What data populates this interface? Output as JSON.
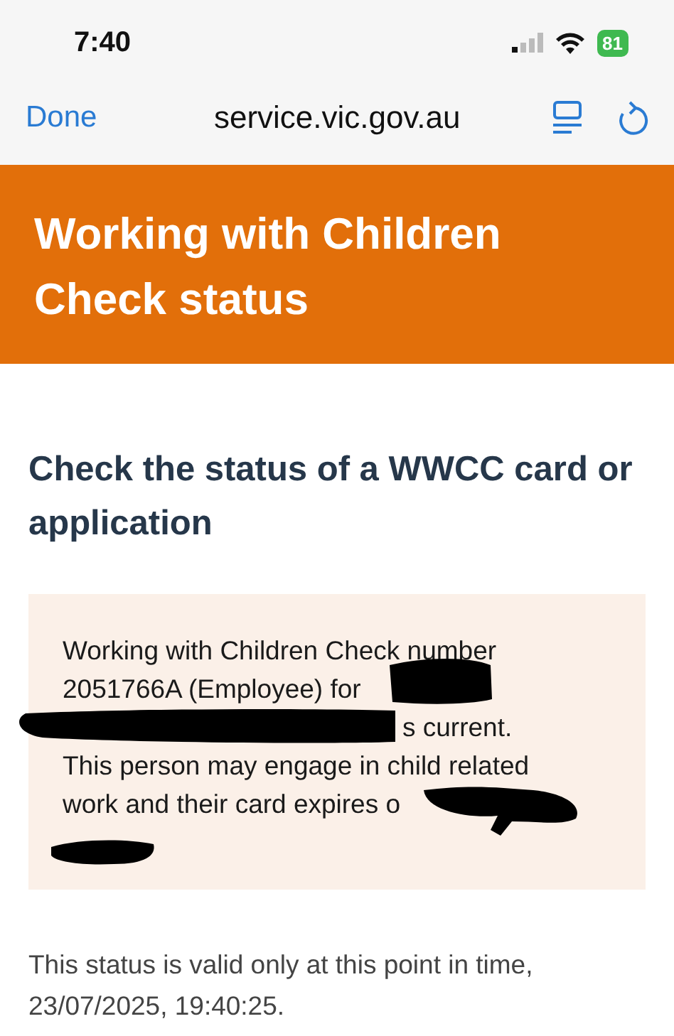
{
  "status_bar": {
    "time": "7:40",
    "battery": "81"
  },
  "browser_bar": {
    "done": "Done",
    "address": "service.vic.gov.au"
  },
  "banner": {
    "title": "Working with Children Check status"
  },
  "heading": "Check the status of a WWCC card or application",
  "notice": {
    "lines": [
      {
        "text": "Working with Children Check number",
        "indent": false
      },
      {
        "text": "2051766A (Employee) for",
        "indent": false
      },
      {
        "text": "s current.",
        "indent": true
      },
      {
        "text": "This person may engage in child related",
        "indent": false
      },
      {
        "text": "work and their card expires o",
        "indent": false
      }
    ]
  },
  "footer_note": "This status is valid only at this point in time, 23/07/2025, 19:40:25."
}
